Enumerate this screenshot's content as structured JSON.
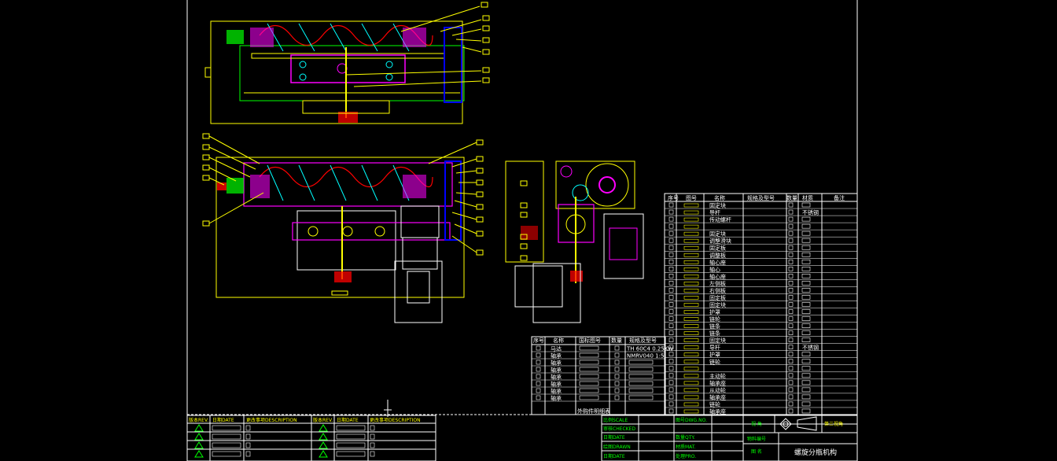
{
  "drawing": {
    "title": "螺旋分瓶机构",
    "projection_label": "第三视角",
    "views": [
      "top-view",
      "front-view",
      "side-view"
    ]
  },
  "bom_main": {
    "headers": [
      "序号",
      "图号",
      "名称",
      "规格及型号",
      "数量",
      "材质",
      "备注"
    ],
    "names": [
      "固定块",
      "导杆",
      "传动螺杆",
      "",
      "固定块",
      "调整滑块",
      "固定板",
      "调整板",
      "轴心座",
      "轴心",
      "轴心座",
      "左侧板",
      "右侧板",
      "固定板",
      "固定块",
      "护罩",
      "链轮",
      "链条",
      "链条",
      "固定块",
      "导杆",
      "护罩",
      "链轮",
      "",
      "主动轮",
      "轴承座",
      "从动轮",
      "轴承座",
      "链轮",
      "轴承座"
    ],
    "materials": [
      "",
      "不锈钢",
      "",
      "",
      "",
      "",
      "",
      "",
      "",
      "",
      "",
      "",
      "",
      "",
      "",
      "",
      "",
      "",
      "",
      "",
      "不锈钢",
      "",
      "",
      "",
      "",
      "",
      "",
      "",
      "",
      ""
    ]
  },
  "bom_purchased": {
    "headers": [
      "序号",
      "名称",
      "国标图号",
      "数量",
      "规格及型号"
    ],
    "rows": [
      {
        "name": "马达",
        "spec": "TH 60C4 0.25KW"
      },
      {
        "name": "轴承",
        "spec": "NMRV040 1:5"
      },
      {
        "name": "轴承",
        "spec": ""
      },
      {
        "name": "轴承",
        "spec": ""
      },
      {
        "name": "轴承",
        "spec": ""
      },
      {
        "name": "轴承",
        "spec": ""
      },
      {
        "name": "轴承",
        "spec": ""
      },
      {
        "name": "轴承",
        "spec": ""
      }
    ],
    "footer": "外购件明细表"
  },
  "title_block": {
    "scale_label": "比例SCALE",
    "drawing_no_label": "图号DWG.NO.",
    "checked_label": "审核CHECKED",
    "quantity_label": "数量QTY.",
    "date_label": "日期DATE",
    "material_label": "材质MAT.",
    "drawn_label": "绘图DRAWN",
    "process_label": "处理PRO.",
    "date2_label": "日期DATE",
    "angle_label": "视 角",
    "material_no_label": "物料编号",
    "figure_name_label": "图 名"
  },
  "revision_block": {
    "col_rev": "版本REV.",
    "col_date": "日期DATE",
    "col_desc": "更改事项DESCRIPTION"
  },
  "colors": {
    "outline": "#ffff00",
    "part": "#ff00ff",
    "screw": "#00ffff",
    "spring": "#ff0000",
    "frame": "#0000ff",
    "green": "#00ff00",
    "white": "#ffffff"
  }
}
